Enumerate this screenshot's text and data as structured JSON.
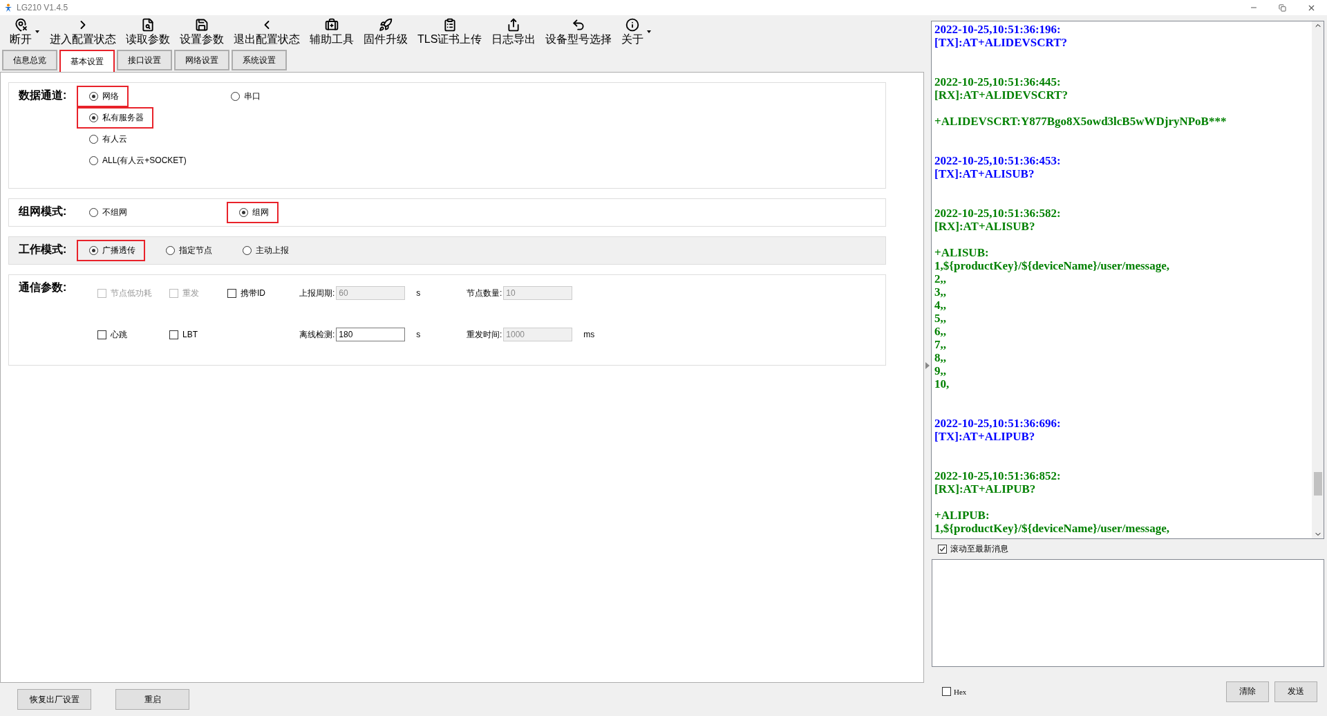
{
  "window": {
    "title": "LG210 V1.4.5"
  },
  "toolbar": [
    {
      "label": "断开",
      "dropdown": true
    },
    {
      "label": "进入配置状态",
      "dropdown": false
    },
    {
      "label": "读取参数",
      "dropdown": false
    },
    {
      "label": "设置参数",
      "dropdown": false
    },
    {
      "label": "退出配置状态",
      "dropdown": false
    },
    {
      "label": "辅助工具",
      "dropdown": false
    },
    {
      "label": "固件升级",
      "dropdown": false
    },
    {
      "label": "TLS证书上传",
      "dropdown": false
    },
    {
      "label": "日志导出",
      "dropdown": false
    },
    {
      "label": "设备型号选择",
      "dropdown": false
    },
    {
      "label": "关于",
      "dropdown": true
    }
  ],
  "tabs": [
    {
      "label": "信息总览",
      "selected": false,
      "highlighted": false
    },
    {
      "label": "基本设置",
      "selected": true,
      "highlighted": true
    },
    {
      "label": "接口设置",
      "selected": false,
      "highlighted": false
    },
    {
      "label": "网络设置",
      "selected": false,
      "highlighted": false
    },
    {
      "label": "系统设置",
      "selected": false,
      "highlighted": false
    }
  ],
  "data_channel": {
    "label": "数据通道:",
    "options": [
      {
        "label": "网络",
        "selected": true,
        "highlighted": true
      },
      {
        "label": "串口",
        "selected": false,
        "highlighted": false
      }
    ],
    "sub_options": [
      {
        "label": "私有服务器",
        "selected": true,
        "highlighted": true
      },
      {
        "label": "有人云",
        "selected": false,
        "highlighted": false
      },
      {
        "label": "ALL(有人云+SOCKET)",
        "selected": false,
        "highlighted": false
      }
    ]
  },
  "network_mode": {
    "label": "组网模式:",
    "options": [
      {
        "label": "不组网",
        "selected": false,
        "highlighted": false
      },
      {
        "label": "组网",
        "selected": true,
        "highlighted": true
      }
    ]
  },
  "work_mode": {
    "label": "工作模式:",
    "options": [
      {
        "label": "广播透传",
        "selected": true,
        "highlighted": true
      },
      {
        "label": "指定节点",
        "selected": false,
        "highlighted": false
      },
      {
        "label": "主动上报",
        "selected": false,
        "highlighted": false
      }
    ]
  },
  "comm_params": {
    "label": "通信参数:",
    "rows": [
      [
        {
          "kind": "checkbox",
          "label": "节点低功耗",
          "checked": false,
          "disabled": true
        },
        {
          "kind": "checkbox",
          "label": "重发",
          "checked": false,
          "disabled": true
        },
        {
          "kind": "checkbox",
          "label": "携带ID",
          "checked": false,
          "disabled": false
        },
        {
          "kind": "field",
          "label": "上报周期:",
          "value": "60",
          "unit": "s",
          "disabled": true
        },
        {
          "kind": "field",
          "label": "节点数量:",
          "value": "10",
          "disabled": true
        }
      ],
      [
        {
          "kind": "checkbox",
          "label": "心跳",
          "checked": false,
          "disabled": false
        },
        {
          "kind": "checkbox",
          "label": "LBT",
          "checked": false,
          "disabled": false
        },
        "",
        {
          "kind": "field",
          "label": "离线检测:",
          "value": "180",
          "unit": "s",
          "disabled": false
        },
        {
          "kind": "field",
          "label": "重发时间:",
          "value": "1000",
          "unit": "ms",
          "disabled": true
        }
      ]
    ]
  },
  "footer_buttons": [
    "恢复出厂设置",
    "重启"
  ],
  "log": {
    "entries": [
      {
        "kind": "tx",
        "lines": [
          "2022-10-25,10:51:36:196:",
          "[TX]:AT+ALIDEVSCRT?"
        ]
      },
      {
        "kind": "rx",
        "lines": [
          "2022-10-25,10:51:36:445:",
          "[RX]:AT+ALIDEVSCRT?"
        ],
        "response": [
          "+ALIDEVSCRT:Y877Bgo8X5owd3lcB5wWDjryNPoB***"
        ]
      },
      {
        "kind": "tx",
        "lines": [
          "2022-10-25,10:51:36:453:",
          "[TX]:AT+ALISUB?"
        ]
      },
      {
        "kind": "rx",
        "lines": [
          "2022-10-25,10:51:36:582:",
          "[RX]:AT+ALISUB?"
        ],
        "response": [
          "+ALISUB:",
          "1,${productKey}/${deviceName}/user/message,",
          "2,,",
          "3,,",
          "4,,",
          "5,,",
          "6,,",
          "7,,",
          "8,,",
          "9,,",
          "10,"
        ]
      },
      {
        "kind": "tx",
        "lines": [
          "2022-10-25,10:51:36:696:",
          "[TX]:AT+ALIPUB?"
        ]
      },
      {
        "kind": "rx",
        "lines": [
          "2022-10-25,10:51:36:852:",
          "[RX]:AT+ALIPUB?"
        ],
        "response": [
          "+ALIPUB:",
          "1,${productKey}/${deviceName}/user/message,"
        ]
      }
    ]
  },
  "scroll_to_latest": {
    "label": "滚动至最新消息",
    "checked": true
  },
  "hex": {
    "label": "Hex",
    "checked": false
  },
  "send_buttons": [
    "清除",
    "发送"
  ]
}
